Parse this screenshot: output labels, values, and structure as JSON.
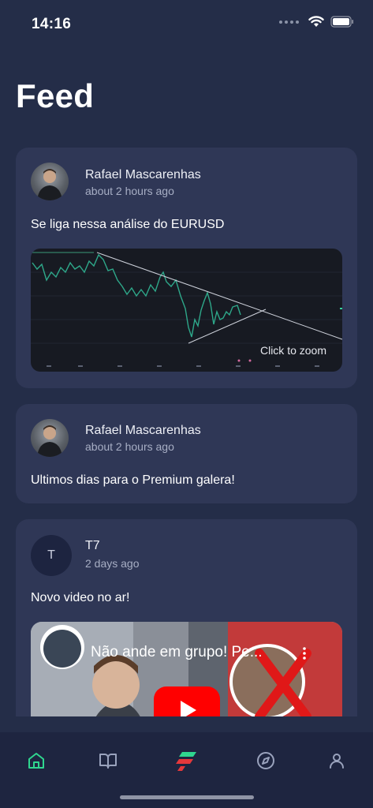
{
  "status_bar": {
    "time": "14:16"
  },
  "header": {
    "title": "Feed"
  },
  "posts": [
    {
      "author": "Rafael Mascarenhas",
      "time": "about 2 hours ago",
      "text": "Se liga nessa análise do EURUSD",
      "media": {
        "type": "chart-image",
        "zoom_label": "Click to zoom"
      }
    },
    {
      "author": "Rafael Mascarenhas",
      "time": "about 2 hours ago",
      "text": "Ultimos dias para o Premium galera!"
    },
    {
      "author": "T7",
      "avatar_letter": "T",
      "time": "2 days ago",
      "text": "Novo video no ar!",
      "media": {
        "type": "youtube-video",
        "title": "Não ande em grupo! Pe..."
      }
    }
  ],
  "tab_bar": {
    "items": [
      {
        "icon": "home-icon",
        "active": true
      },
      {
        "icon": "book-icon",
        "active": false
      },
      {
        "icon": "logo-icon",
        "active": false
      },
      {
        "icon": "compass-icon",
        "active": false
      },
      {
        "icon": "profile-icon",
        "active": false
      }
    ],
    "active_color": "#2fd68f",
    "inactive_color": "#9aa3bd"
  },
  "colors": {
    "background": "#242d48",
    "card": "#2f3756",
    "tab_bar": "#1e2540"
  }
}
